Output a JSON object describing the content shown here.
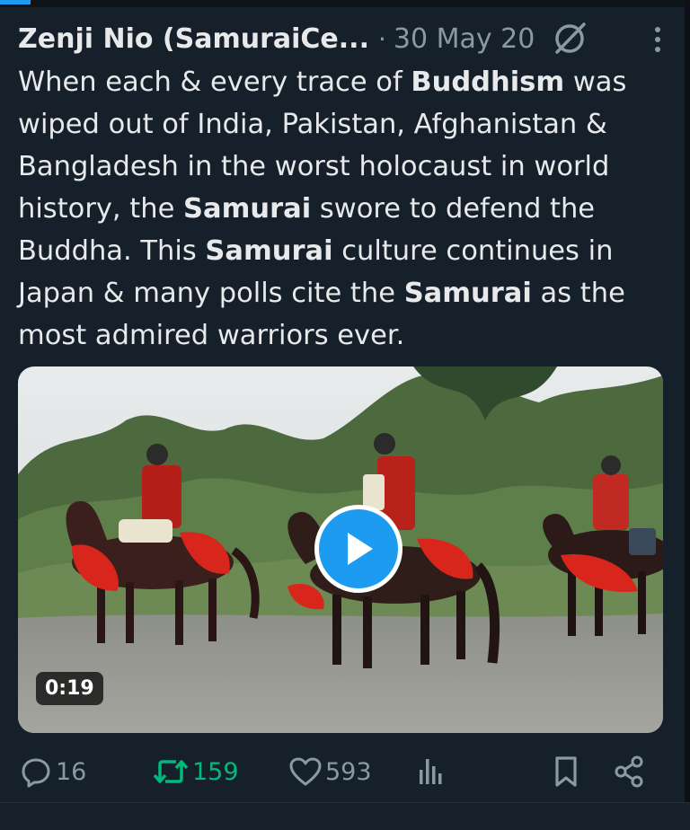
{
  "tweet": {
    "author_name": "Zenji Nio (SamuraiCe...",
    "separator": "·",
    "date": "30 May 20",
    "text_segments": [
      {
        "text": "When each & every trace of ",
        "bold": false
      },
      {
        "text": "Buddhism",
        "bold": true
      },
      {
        "text": " was wiped out of India, Pakistan, Afghanistan & Bangladesh in the worst holocaust in world history, the ",
        "bold": false
      },
      {
        "text": "Samurai",
        "bold": true
      },
      {
        "text": " swore to defend the Buddha. This ",
        "bold": false
      },
      {
        "text": "Samurai",
        "bold": true
      },
      {
        "text": " culture continues in Japan & many polls cite the ",
        "bold": false
      },
      {
        "text": "Samurai",
        "bold": true
      },
      {
        "text": " as the most admired warriors ever.",
        "bold": false
      }
    ],
    "video": {
      "duration": "0:19"
    },
    "stats": {
      "replies": "16",
      "retweets": "159",
      "likes": "593"
    }
  },
  "icons": {
    "grok": "grok-icon",
    "more": "more-vertical-icon",
    "reply": "reply-icon",
    "retweet": "retweet-icon",
    "like": "heart-icon",
    "views": "views-icon",
    "bookmark": "bookmark-icon",
    "share": "share-icon",
    "play": "play-icon"
  },
  "colors": {
    "background": "#15202b",
    "text": "#e7e9ea",
    "muted": "#8b98a5",
    "accent": "#1d9bf0",
    "retweet_active": "#00ba7c"
  }
}
